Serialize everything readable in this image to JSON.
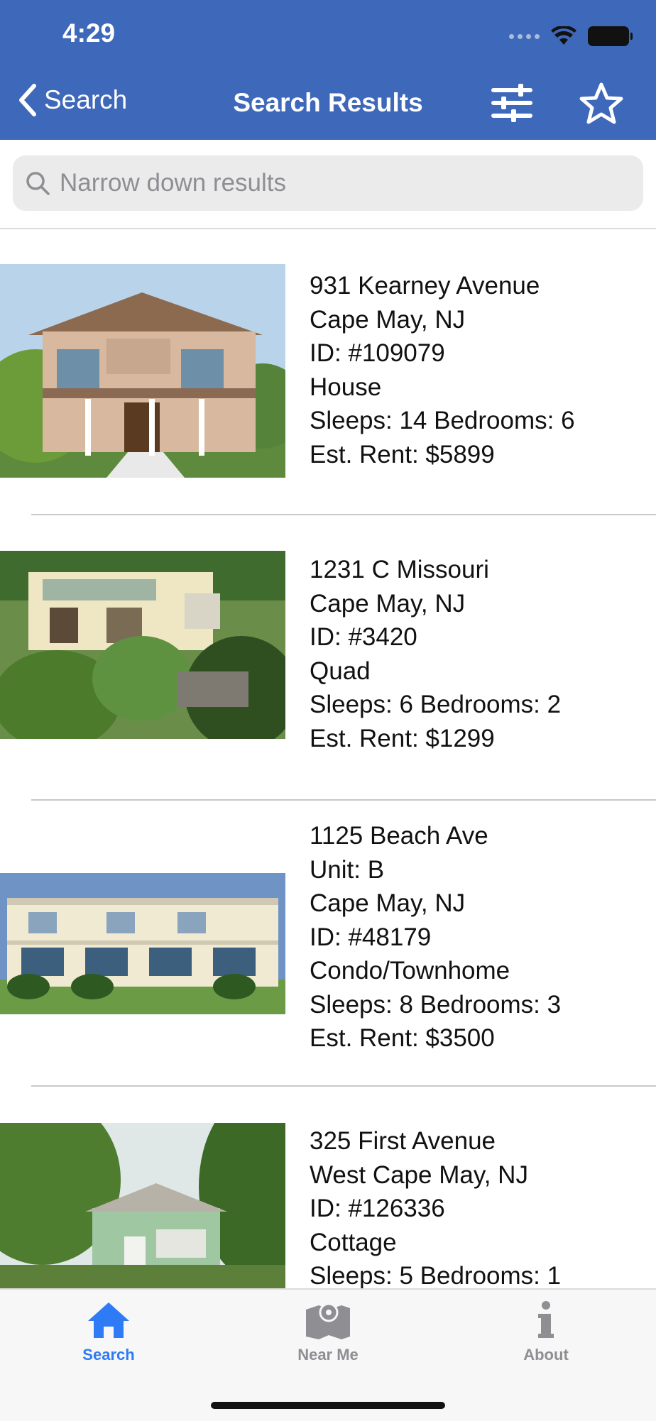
{
  "status_bar": {
    "time": "4:29"
  },
  "nav": {
    "back_label": "Search",
    "title": "Search Results"
  },
  "search": {
    "placeholder": "Narrow down results"
  },
  "listings": [
    {
      "lines": [
        "931 Kearney Avenue",
        "Cape May, NJ",
        "ID: #109079",
        "House",
        "Sleeps: 14  Bedrooms: 6",
        "Est. Rent: $5899"
      ]
    },
    {
      "lines": [
        "1231 C Missouri",
        "Cape May, NJ",
        "ID: #3420",
        "Quad",
        "Sleeps: 6  Bedrooms: 2",
        "Est. Rent: $1299"
      ]
    },
    {
      "lines": [
        "1125 Beach Ave",
        "Unit: B",
        "Cape May, NJ",
        "ID: #48179",
        "Condo/Townhome",
        "Sleeps: 8  Bedrooms: 3",
        "Est. Rent: $3500"
      ]
    },
    {
      "lines": [
        "325 First Avenue",
        "West Cape May, NJ",
        "ID: #126336",
        "Cottage",
        "Sleeps: 5  Bedrooms: 1"
      ]
    }
  ],
  "tabs": [
    {
      "label": "Search",
      "icon": "home-icon",
      "active": true
    },
    {
      "label": "Near Me",
      "icon": "map-pin-icon",
      "active": false
    },
    {
      "label": "About",
      "icon": "info-icon",
      "active": false
    }
  ],
  "colors": {
    "header": "#3e68b9",
    "tab_active": "#2f7bf5",
    "tab_inactive": "#8e8e93"
  }
}
